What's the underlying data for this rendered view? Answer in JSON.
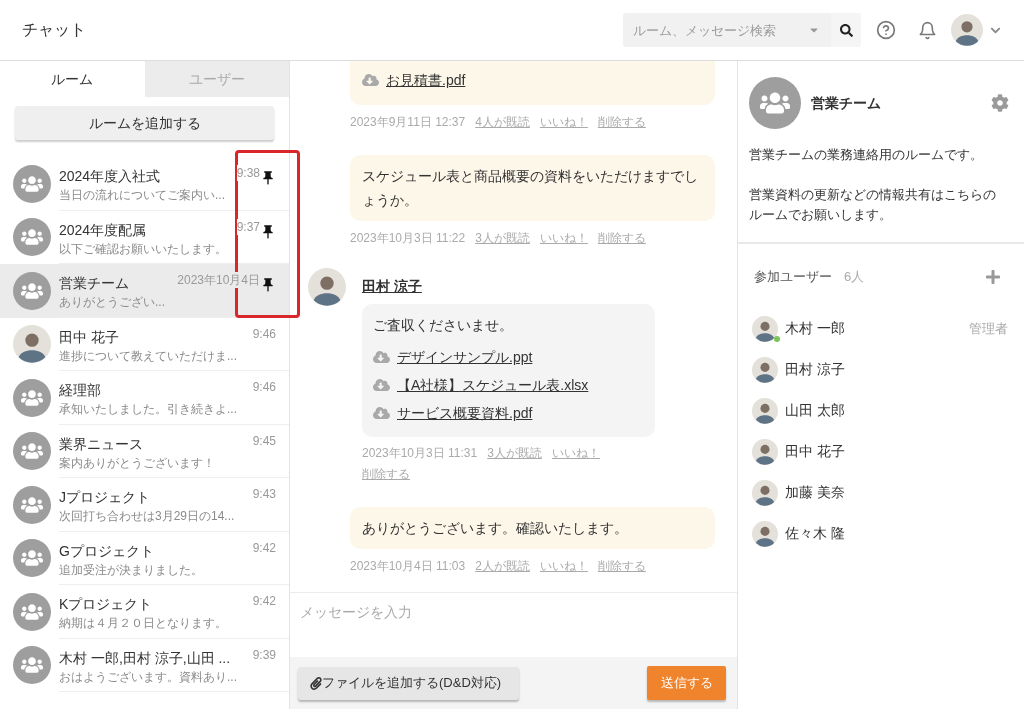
{
  "header": {
    "title": "チャット",
    "search": {
      "placeholder": "ルーム、メッセージ検索"
    }
  },
  "sidebar": {
    "tabs": [
      {
        "label": "ルーム",
        "selected": true
      },
      {
        "label": "ユーザー",
        "selected": false
      }
    ],
    "add_button": "ルームを追加する",
    "rooms": [
      {
        "name": "2024年度入社式",
        "preview": "当日の流れについてご案内い...",
        "time": "9:38",
        "kind": "group",
        "pinned": true,
        "selected": false
      },
      {
        "name": "2024年度配属",
        "preview": "以下ご確認お願いいたします。",
        "time": "9:37",
        "kind": "group",
        "pinned": true,
        "selected": false
      },
      {
        "name": "営業チーム",
        "preview": "ありがとうござい...",
        "time": "2023年10月4日",
        "kind": "group",
        "pinned": true,
        "selected": true
      },
      {
        "name": "田中 花子",
        "preview": "進捗について教えていただけま...",
        "time": "9:46",
        "kind": "person",
        "pinned": false,
        "selected": false
      },
      {
        "name": "経理部",
        "preview": "承知いたしました。引き続きよ...",
        "time": "9:46",
        "kind": "group",
        "pinned": false,
        "selected": false
      },
      {
        "name": "業界ニュース",
        "preview": "案内ありがとうございます！",
        "time": "9:45",
        "kind": "group",
        "pinned": false,
        "selected": false
      },
      {
        "name": "Jプロジェクト",
        "preview": "次回打ち合わせは3月29日の14...",
        "time": "9:43",
        "kind": "group",
        "pinned": false,
        "selected": false
      },
      {
        "name": "Gプロジェクト",
        "preview": "追加受注が決まりました。",
        "time": "9:42",
        "kind": "group",
        "pinned": false,
        "selected": false
      },
      {
        "name": "Kプロジェクト",
        "preview": "納期は４月２０日となります。",
        "time": "9:42",
        "kind": "group",
        "pinned": false,
        "selected": false
      },
      {
        "name": "木村 一郎,田村 涼子,山田 ...",
        "preview": "おはようございます。資料あり...",
        "time": "9:39",
        "kind": "group",
        "pinned": false,
        "selected": false
      }
    ]
  },
  "chat": {
    "messages": [
      {
        "kind": "sent",
        "files": [
          "お見積書.pdf"
        ],
        "time": "2023年9月11日 12:37",
        "read": "4人が既読",
        "like": "いいね！",
        "delete": "削除する"
      },
      {
        "kind": "sent",
        "text": "スケジュール表と商品概要の資料をいただけますでしょうか。",
        "time": "2023年10月3日 11:22",
        "read": "3人が既読",
        "like": "いいね！",
        "delete": "削除する"
      },
      {
        "kind": "received",
        "sender": "田村 涼子",
        "text": "ご査収くださいませ。",
        "files": [
          "デザインサンプル.ppt",
          "【A社様】スケジュール表.xlsx",
          "サービス概要資料.pdf"
        ],
        "time": "2023年10月3日 11:31",
        "read": "3人が既読",
        "like": "いいね！",
        "delete": "削除する"
      },
      {
        "kind": "sent",
        "text": "ありがとうございます。確認いたします。",
        "time": "2023年10月4日 11:03",
        "read": "2人が既読",
        "like": "いいね！",
        "delete": "削除する"
      }
    ],
    "input": {
      "placeholder": "メッセージを入力"
    },
    "attach_button": "ファイルを追加する(D&D対応)",
    "send_button": "送信する"
  },
  "room_info": {
    "name": "営業チーム",
    "description": [
      "営業チームの業務連絡用のルームです。",
      "営業資料の更新などの情報共有はこちらのルームでお願いします。"
    ],
    "members_label": "参加ユーザー",
    "members_count": "6人",
    "members": [
      {
        "name": "木村 一郎",
        "role": "管理者",
        "online": true
      },
      {
        "name": "田村 涼子",
        "online": false
      },
      {
        "name": "山田 太郎",
        "online": false
      },
      {
        "name": "田中 花子",
        "online": false
      },
      {
        "name": "加藤 美奈",
        "online": false
      },
      {
        "name": "佐々木 隆",
        "online": false
      }
    ]
  }
}
